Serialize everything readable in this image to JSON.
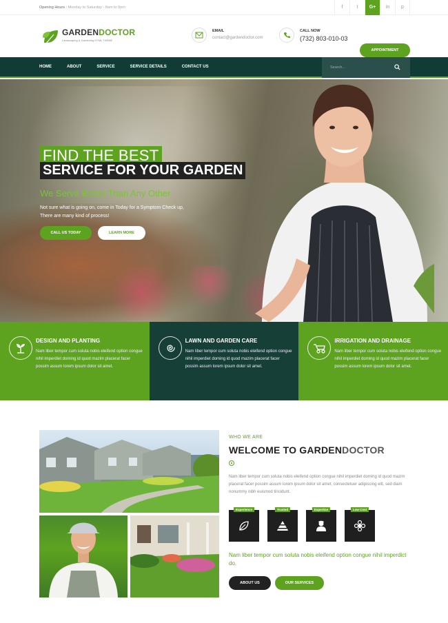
{
  "topbar": {
    "hours_label": "Opening Hours :",
    "hours_value": "Monday to Saturday - 8am to 9pm",
    "socials": [
      {
        "icon": "facebook-icon",
        "glyph": "f"
      },
      {
        "icon": "twitter-icon",
        "glyph": "t"
      },
      {
        "icon": "google-plus-icon",
        "glyph": "G+"
      },
      {
        "icon": "linkedin-icon",
        "glyph": "in"
      },
      {
        "icon": "pinterest-icon",
        "glyph": "p"
      }
    ]
  },
  "header": {
    "logo_first": "GARDEN",
    "logo_second": "DOCTOR",
    "tagline": "Landscaping & Gardening HTML THEME",
    "email_label": "EMAIL",
    "email_value": "contact@gardendoctor.com",
    "call_label": "CALL NOW",
    "call_value": "(732) 803-010-03",
    "appointment": "APPOINTMENT"
  },
  "nav": {
    "items": [
      "HOME",
      "ABOUT",
      "SERVICE",
      "SERVICE DETAILS",
      "CONTACT US"
    ],
    "search_placeholder": "Search..."
  },
  "hero": {
    "line1": "FIND THE BEST",
    "line2": "SERVICE FOR YOUR GARDEN",
    "subtitle": "We Serve Better Than Any Other",
    "description": "Not sure what is going on, come in Today for a Symptom Check up, There are many kind of process!",
    "btn_call": "CALL US TODAY",
    "btn_learn": "LEARN MORE"
  },
  "features": [
    {
      "title": "DESIGN AND PLANTING",
      "text": "Nam liber tempor cum soluta nobis eleifend option congue nihil imperdiet doming id quod mazim placerat facer possim assum lorem ipsum dolor sit amet."
    },
    {
      "title": "LAWN AND GARDEN CARE",
      "text": "Nam liber tempor cum soluta nobis eleifend option congue nihil imperdiet doming id quod mazim placerat facer possim assum lorem ipsum dolor sit amet."
    },
    {
      "title": "IRRIGATION AND DRAINAGE",
      "text": "Nam liber tempor cum soluta nobis eleifend option congue nihil imperdiet doming id quod mazim placerat facer possim assum lorem ipsum dolor sit amet."
    }
  ],
  "about": {
    "kicker": "WHO WE ARE",
    "title_first": "WELCOME TO GARDEN",
    "title_second": "DOCTOR",
    "text": "Nam liber tempor cum soluta nobis eleifend option congue nihil imperdiet doming id quod mazim placerat facer possim assum lorem ipsum dolor sit amet, consectetuer adipiscing elit, sed diam nonummy nibh euismod tincidunt.",
    "boxes": [
      "Experience",
      "Trusted",
      "Expertise",
      "Low Cost"
    ],
    "green_text": "Nam liber tempor cum soluta nobis eleifend option congue nihil imperdict do.",
    "btn_about": "ABOUT US",
    "btn_services": "OUR SERVICES"
  },
  "colors": {
    "accent": "#5ea320",
    "dark": "#113c36",
    "dark_panel": "#163f38"
  }
}
